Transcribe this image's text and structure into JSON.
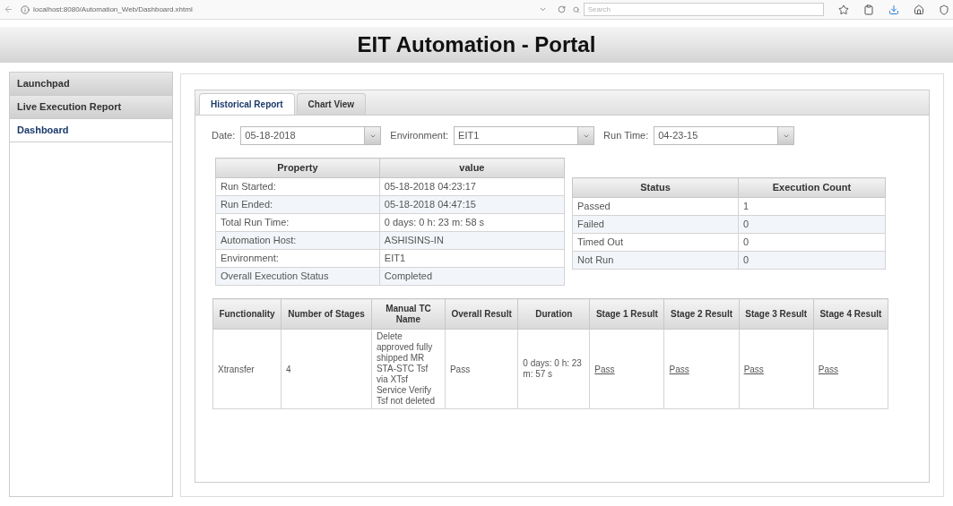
{
  "browser": {
    "url": "localhost:8080/Automation_Web/Dashboard.xhtml",
    "search_placeholder": "Search"
  },
  "title": "EIT Automation - Portal",
  "sidebar": {
    "items": [
      {
        "label": "Launchpad",
        "selected": false
      },
      {
        "label": "Live Execution Report",
        "selected": false
      },
      {
        "label": "Dashboard",
        "selected": true
      }
    ]
  },
  "tabs": [
    {
      "label": "Historical Report",
      "selected": true
    },
    {
      "label": "Chart View",
      "selected": false
    }
  ],
  "filters": [
    {
      "label": "Date:",
      "value": "05-18-2018"
    },
    {
      "label": "Environment:",
      "value": "EIT1"
    },
    {
      "label": "Run Time:",
      "value": "04-23-15"
    }
  ],
  "property_table": {
    "columns": [
      "Property",
      "value"
    ],
    "rows": [
      [
        "Run Started:",
        "05-18-2018 04:23:17"
      ],
      [
        "Run Ended:",
        "05-18-2018 04:47:15"
      ],
      [
        "Total Run Time:",
        "0 days: 0 h: 23 m: 58 s"
      ],
      [
        "Automation Host:",
        "ASHISINS-IN"
      ],
      [
        "Environment:",
        "EIT1"
      ],
      [
        "Overall Execution Status",
        "Completed"
      ]
    ]
  },
  "status_table": {
    "columns": [
      "Status",
      "Execution Count"
    ],
    "rows": [
      [
        "Passed",
        "1"
      ],
      [
        "Failed",
        "0"
      ],
      [
        "Timed Out",
        "0"
      ],
      [
        "Not Run",
        "0"
      ]
    ]
  },
  "results_table": {
    "columns": [
      "Functionality",
      "Number of Stages",
      "Manual TC Name",
      "Overall Result",
      "Duration",
      "Stage 1 Result",
      "Stage 2 Result",
      "Stage 3 Result",
      "Stage 4 Result"
    ],
    "rows": [
      [
        {
          "text": "Xtransfer",
          "kind": "text"
        },
        {
          "text": "4",
          "kind": "text"
        },
        {
          "text": "Delete approved fully shipped MR STA-STC Tsf via XTsf Service Verify Tsf not deleted",
          "kind": "text"
        },
        {
          "text": "Pass",
          "kind": "text"
        },
        {
          "text": "0 days: 0 h: 23 m: 57 s",
          "kind": "text"
        },
        {
          "text": "Pass",
          "kind": "link"
        },
        {
          "text": "Pass",
          "kind": "link"
        },
        {
          "text": "Pass",
          "kind": "link"
        },
        {
          "text": "Pass",
          "kind": "link"
        }
      ]
    ]
  }
}
